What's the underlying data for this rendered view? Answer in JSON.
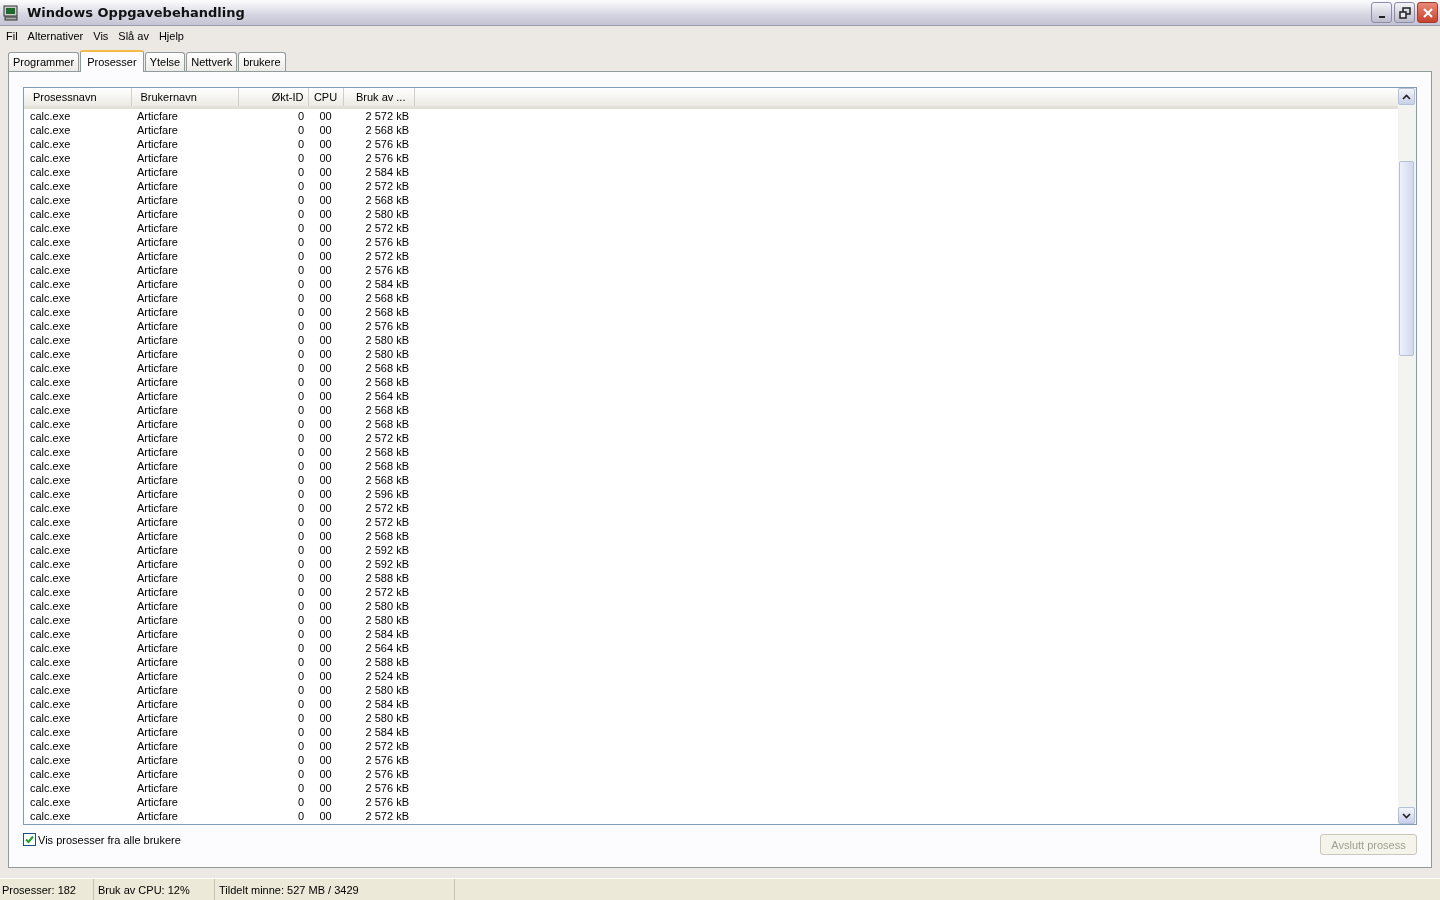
{
  "window": {
    "title": "Windows Oppgavebehandling"
  },
  "menu": [
    "Fil",
    "Alternativer",
    "Vis",
    "Slå av",
    "Hjelp"
  ],
  "tabs": [
    {
      "label": "Programmer",
      "selected": false
    },
    {
      "label": "Prosesser",
      "selected": true
    },
    {
      "label": "Ytelse",
      "selected": false
    },
    {
      "label": "Nettverk",
      "selected": false
    },
    {
      "label": "brukere",
      "selected": false
    }
  ],
  "table": {
    "columns": [
      "Prosessnavn",
      "Brukernavn",
      "Økt-ID",
      "CPU",
      "Bruk av ..."
    ],
    "rows": [
      [
        "calc.exe",
        "Articfare",
        "0",
        "00",
        "2 572 kB"
      ],
      [
        "calc.exe",
        "Articfare",
        "0",
        "00",
        "2 568 kB"
      ],
      [
        "calc.exe",
        "Articfare",
        "0",
        "00",
        "2 576 kB"
      ],
      [
        "calc.exe",
        "Articfare",
        "0",
        "00",
        "2 576 kB"
      ],
      [
        "calc.exe",
        "Articfare",
        "0",
        "00",
        "2 584 kB"
      ],
      [
        "calc.exe",
        "Articfare",
        "0",
        "00",
        "2 572 kB"
      ],
      [
        "calc.exe",
        "Articfare",
        "0",
        "00",
        "2 568 kB"
      ],
      [
        "calc.exe",
        "Articfare",
        "0",
        "00",
        "2 580 kB"
      ],
      [
        "calc.exe",
        "Articfare",
        "0",
        "00",
        "2 572 kB"
      ],
      [
        "calc.exe",
        "Articfare",
        "0",
        "00",
        "2 576 kB"
      ],
      [
        "calc.exe",
        "Articfare",
        "0",
        "00",
        "2 572 kB"
      ],
      [
        "calc.exe",
        "Articfare",
        "0",
        "00",
        "2 576 kB"
      ],
      [
        "calc.exe",
        "Articfare",
        "0",
        "00",
        "2 584 kB"
      ],
      [
        "calc.exe",
        "Articfare",
        "0",
        "00",
        "2 568 kB"
      ],
      [
        "calc.exe",
        "Articfare",
        "0",
        "00",
        "2 568 kB"
      ],
      [
        "calc.exe",
        "Articfare",
        "0",
        "00",
        "2 576 kB"
      ],
      [
        "calc.exe",
        "Articfare",
        "0",
        "00",
        "2 580 kB"
      ],
      [
        "calc.exe",
        "Articfare",
        "0",
        "00",
        "2 580 kB"
      ],
      [
        "calc.exe",
        "Articfare",
        "0",
        "00",
        "2 568 kB"
      ],
      [
        "calc.exe",
        "Articfare",
        "0",
        "00",
        "2 568 kB"
      ],
      [
        "calc.exe",
        "Articfare",
        "0",
        "00",
        "2 564 kB"
      ],
      [
        "calc.exe",
        "Articfare",
        "0",
        "00",
        "2 568 kB"
      ],
      [
        "calc.exe",
        "Articfare",
        "0",
        "00",
        "2 568 kB"
      ],
      [
        "calc.exe",
        "Articfare",
        "0",
        "00",
        "2 572 kB"
      ],
      [
        "calc.exe",
        "Articfare",
        "0",
        "00",
        "2 568 kB"
      ],
      [
        "calc.exe",
        "Articfare",
        "0",
        "00",
        "2 568 kB"
      ],
      [
        "calc.exe",
        "Articfare",
        "0",
        "00",
        "2 568 kB"
      ],
      [
        "calc.exe",
        "Articfare",
        "0",
        "00",
        "2 596 kB"
      ],
      [
        "calc.exe",
        "Articfare",
        "0",
        "00",
        "2 572 kB"
      ],
      [
        "calc.exe",
        "Articfare",
        "0",
        "00",
        "2 572 kB"
      ],
      [
        "calc.exe",
        "Articfare",
        "0",
        "00",
        "2 568 kB"
      ],
      [
        "calc.exe",
        "Articfare",
        "0",
        "00",
        "2 592 kB"
      ],
      [
        "calc.exe",
        "Articfare",
        "0",
        "00",
        "2 592 kB"
      ],
      [
        "calc.exe",
        "Articfare",
        "0",
        "00",
        "2 588 kB"
      ],
      [
        "calc.exe",
        "Articfare",
        "0",
        "00",
        "2 572 kB"
      ],
      [
        "calc.exe",
        "Articfare",
        "0",
        "00",
        "2 580 kB"
      ],
      [
        "calc.exe",
        "Articfare",
        "0",
        "00",
        "2 580 kB"
      ],
      [
        "calc.exe",
        "Articfare",
        "0",
        "00",
        "2 584 kB"
      ],
      [
        "calc.exe",
        "Articfare",
        "0",
        "00",
        "2 564 kB"
      ],
      [
        "calc.exe",
        "Articfare",
        "0",
        "00",
        "2 588 kB"
      ],
      [
        "calc.exe",
        "Articfare",
        "0",
        "00",
        "2 524 kB"
      ],
      [
        "calc.exe",
        "Articfare",
        "0",
        "00",
        "2 580 kB"
      ],
      [
        "calc.exe",
        "Articfare",
        "0",
        "00",
        "2 584 kB"
      ],
      [
        "calc.exe",
        "Articfare",
        "0",
        "00",
        "2 580 kB"
      ],
      [
        "calc.exe",
        "Articfare",
        "0",
        "00",
        "2 584 kB"
      ],
      [
        "calc.exe",
        "Articfare",
        "0",
        "00",
        "2 572 kB"
      ],
      [
        "calc.exe",
        "Articfare",
        "0",
        "00",
        "2 576 kB"
      ],
      [
        "calc.exe",
        "Articfare",
        "0",
        "00",
        "2 576 kB"
      ],
      [
        "calc.exe",
        "Articfare",
        "0",
        "00",
        "2 576 kB"
      ],
      [
        "calc.exe",
        "Articfare",
        "0",
        "00",
        "2 576 kB"
      ],
      [
        "calc.exe",
        "Articfare",
        "0",
        "00",
        "2 572 kB"
      ]
    ]
  },
  "show_all_users": {
    "label": "Vis prosesser fra alle brukere",
    "checked": true
  },
  "end_process_button": {
    "label": "Avslutt prosess",
    "disabled": true
  },
  "status_bar": [
    "Prosesser: 182",
    "Bruk av CPU: 12%",
    "Tildelt minne: 527 MB / 3429"
  ]
}
